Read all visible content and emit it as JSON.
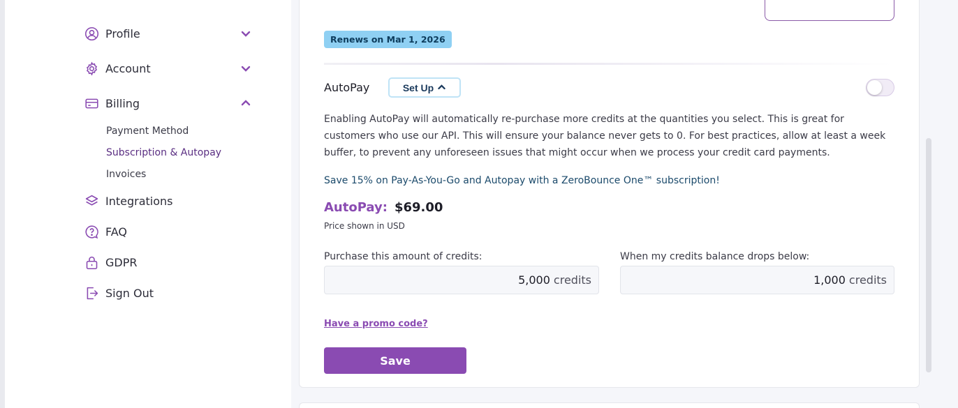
{
  "sidebar": {
    "items": [
      {
        "label": "Profile",
        "icon": "user-circle-icon",
        "expanded": false
      },
      {
        "label": "Account",
        "icon": "gear-icon",
        "expanded": false
      },
      {
        "label": "Billing",
        "icon": "credit-card-icon",
        "expanded": true
      },
      {
        "label": "Integrations",
        "icon": "layers-icon"
      },
      {
        "label": "FAQ",
        "icon": "question-bubble-icon"
      },
      {
        "label": "GDPR",
        "icon": "lock-icon"
      },
      {
        "label": "Sign Out",
        "icon": "sign-out-icon"
      }
    ],
    "billing_sub": [
      {
        "label": "Payment Method",
        "active": false
      },
      {
        "label": "Subscription & Autopay",
        "active": true
      },
      {
        "label": "Invoices",
        "active": false
      }
    ]
  },
  "main": {
    "renews_badge": "Renews on Mar 1, 2026",
    "autopay_title": "AutoPay",
    "setup_button": "Set Up",
    "autopay_enabled": false,
    "description": "Enabling AutoPay will automatically re-purchase more credits at the quantities you select. This is great for customers who use our API. This will ensure your balance never gets to 0. For best practices, allow at least a week buffer, to prevent any unforeseen issues that might occur when we process your credit card payments.",
    "promo_line": "Save 15% on Pay-As-You-Go and Autopay with a ZeroBounce One™ subscription!",
    "price_label": "AutoPay:",
    "price_value": "$69.00",
    "price_note": "Price shown in USD",
    "purchase_label": "Purchase this amount of credits:",
    "purchase_value": "5,000",
    "purchase_unit": "credits",
    "threshold_label": "When my credits balance drops below:",
    "threshold_value": "1,000",
    "threshold_unit": "credits",
    "promo_link": "Have a promo code?",
    "save_button": "Save"
  },
  "colors": {
    "accent": "#8a4bb2",
    "active_sub": "#5a2e82",
    "badge": "#8fd0f3",
    "link_blue": "#1b4a6b"
  }
}
